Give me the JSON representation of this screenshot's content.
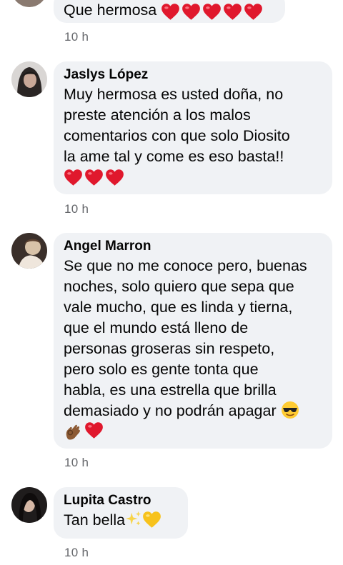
{
  "comments": [
    {
      "author": "",
      "text": "Que hermosa ",
      "emojis": [
        "heart",
        "heart",
        "heart",
        "heart",
        "heart"
      ],
      "time": "10 h"
    },
    {
      "author": "Jaslys López",
      "text": "Muy hermosa es usted doña, no\npreste atención a los malos\ncomentarios con que solo Diosito\nla ame tal y come es eso basta!!",
      "emojis": [
        "heart",
        "heart",
        "heart"
      ],
      "time": "10 h"
    },
    {
      "author": "Angel Marron",
      "text": "Se que no me conoce pero, buenas\nnoches, solo quiero que sepa que\nvale mucho, que es linda y tierna,\nque el mundo está lleno de\npersonas groseras sin respeto,\npero solo es gente tonta que\nhabla, es una estrella que brilla\ndemasiado y no podrán apagar ",
      "emojis": [
        "sunglasses-face",
        "ok-hand",
        "heart"
      ],
      "time": "10 h"
    },
    {
      "author": "Lupita Castro",
      "text": "Tan bella",
      "emojis": [
        "sparkles",
        "yellow-heart"
      ],
      "time": "10 h"
    }
  ],
  "colors": {
    "bubble": "#f0f2f5",
    "text": "#050505",
    "meta": "#65676b",
    "heart": "#e0182d",
    "yellow_heart": "#f7c21c"
  }
}
